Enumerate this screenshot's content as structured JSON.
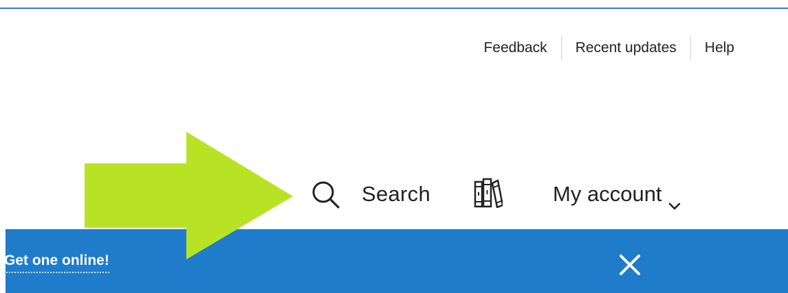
{
  "utility_nav": {
    "feedback": "Feedback",
    "recent_updates": "Recent updates",
    "help": "Help"
  },
  "main_nav": {
    "search_label": "Search",
    "search_icon": "search-icon",
    "shelf_icon": "bookshelf-icon",
    "account_label": "My account",
    "account_icon": "chevron-down-icon"
  },
  "banner": {
    "link_text": "Get one online!",
    "close_icon": "close-icon",
    "background": "#1f7ccb"
  },
  "overlay": {
    "arrow_icon": "arrow-right-icon",
    "arrow_color": "#b8e324"
  },
  "colors": {
    "top_rule": "#2f7dc8",
    "text": "#222222"
  }
}
